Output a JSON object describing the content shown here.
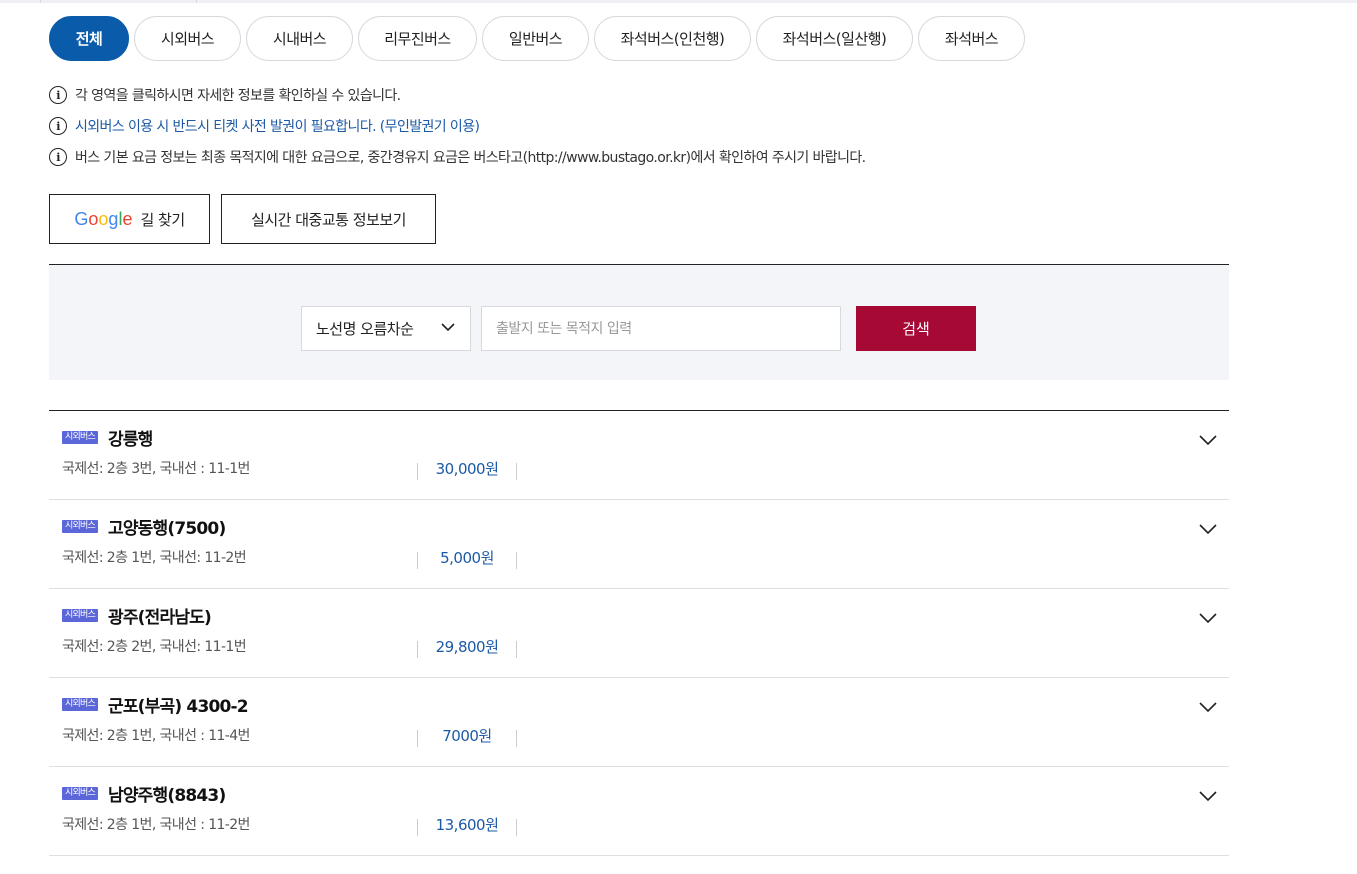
{
  "tabs": [
    {
      "label": "전체",
      "active": true
    },
    {
      "label": "시외버스",
      "active": false
    },
    {
      "label": "시내버스",
      "active": false
    },
    {
      "label": "리무진버스",
      "active": false
    },
    {
      "label": "일반버스",
      "active": false
    },
    {
      "label": "좌석버스(인천행)",
      "active": false
    },
    {
      "label": "좌석버스(일산행)",
      "active": false
    },
    {
      "label": "좌석버스",
      "active": false
    }
  ],
  "notices": [
    "각 영역을 클릭하시면 자세한 정보를 확인하실 수 있습니다.",
    "시외버스 이용 시 반드시 티켓 사전 발권이 필요합니다. (무인발권기 이용)",
    "버스 기본 요금 정보는 최종 목적지에 대한 요금으로, 중간경유지 요금은 버스타고(http://www.bustago.or.kr)에서 확인하여 주시기 바랍니다."
  ],
  "buttons": {
    "google_logo": "Google",
    "google_label": "길 찾기",
    "transit_label": "실시간 대중교통 정보보기"
  },
  "search": {
    "sort_selected": "노선명 오름차순",
    "placeholder": "출발지 또는 목적지 입력",
    "button_label": "검색"
  },
  "routes": [
    {
      "badge": "시외버스",
      "name": "강릉행",
      "info": "국제선: 2층 3번, 국내선 : 11-1번",
      "price": "30,000원"
    },
    {
      "badge": "시외버스",
      "name": "고양동행(7500)",
      "info": "국제선: 2층 1번, 국내선: 11-2번",
      "price": "5,000원"
    },
    {
      "badge": "시외버스",
      "name": "광주(전라남도)",
      "info": "국제선: 2층 2번, 국내선: 11-1번",
      "price": "29,800원"
    },
    {
      "badge": "시외버스",
      "name": "군포(부곡) 4300-2",
      "info": "국제선: 2층 1번, 국내선 : 11-4번",
      "price": "7000원"
    },
    {
      "badge": "시외버스",
      "name": "남양주행(8843)",
      "info": "국제선: 2층 1번, 국내선 : 11-2번",
      "price": "13,600원"
    }
  ],
  "colors": {
    "active_tab": "#0b5bab",
    "search_button": "#a50934",
    "badge": "#5b67d8",
    "price_text": "#1c5aa6"
  }
}
